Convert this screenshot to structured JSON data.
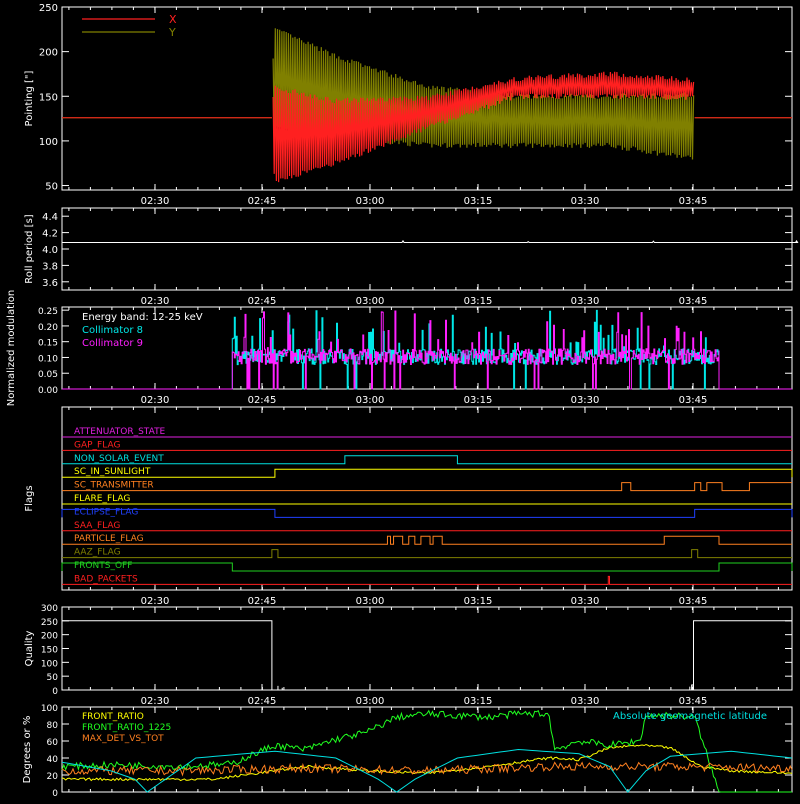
{
  "chart_data": [
    {
      "type": "line",
      "ylabel": "Pointing [\"]",
      "ylim": [
        45,
        250
      ],
      "yticks": [
        50,
        100,
        150,
        200,
        250
      ],
      "xticks": [
        "02:30",
        "02:45",
        "03:00",
        "03:15",
        "03:30",
        "03:45"
      ],
      "legend": [
        {
          "name": "X",
          "color": "#ff2020"
        },
        {
          "name": "Y",
          "color": "#808000"
        }
      ],
      "series": [
        {
          "name": "X",
          "color": "#ff2020",
          "baseline": 126,
          "envelope_upper": [
            [
              34,
              126
            ],
            [
              35,
              160
            ],
            [
              45,
              145
            ],
            [
              60,
              148
            ],
            [
              75,
              170
            ],
            [
              90,
              175
            ],
            [
              104,
              168
            ]
          ],
          "envelope_lower": [
            [
              34,
              126
            ],
            [
              35,
              55
            ],
            [
              45,
              75
            ],
            [
              60,
              115
            ],
            [
              75,
              150
            ],
            [
              90,
              150
            ],
            [
              104,
              148
            ]
          ]
        },
        {
          "name": "Y",
          "color": "#808000",
          "baseline": 126,
          "envelope_upper": [
            [
              34,
              126
            ],
            [
              35,
              225
            ],
            [
              45,
              195
            ],
            [
              60,
              160
            ],
            [
              75,
              150
            ],
            [
              90,
              150
            ],
            [
              104,
              152
            ]
          ],
          "envelope_lower": [
            [
              34,
              126
            ],
            [
              35,
              115
            ],
            [
              45,
              105
            ],
            [
              60,
              95
            ],
            [
              75,
              95
            ],
            [
              90,
              95
            ],
            [
              104,
              80
            ]
          ]
        }
      ]
    },
    {
      "type": "line",
      "ylabel": "Roll period [s]",
      "ylim": [
        3.5,
        4.5
      ],
      "yticks": [
        "3.6",
        "3.8",
        "4.0",
        "4.2",
        "4.4"
      ],
      "xticks": [
        "02:30",
        "02:45",
        "03:00",
        "03:15",
        "03:30",
        "03:45"
      ],
      "series": [
        {
          "name": "roll",
          "color": "#ffffff",
          "value": 4.08
        }
      ]
    },
    {
      "type": "bar",
      "ylabel": "Normalized modulation",
      "ylim": [
        0,
        0.26
      ],
      "yticks": [
        "0.00",
        "0.05",
        "0.10",
        "0.15",
        "0.20",
        "0.25"
      ],
      "xticks": [
        "02:30",
        "02:45",
        "03:00",
        "03:15",
        "03:30",
        "03:45"
      ],
      "annotation": "Energy band: 12-25 keV",
      "legend": [
        {
          "name": "Collimator 8",
          "color": "#00e8e8"
        },
        {
          "name": "Collimator 9",
          "color": "#ff20ff"
        }
      ],
      "series": [
        {
          "name": "Collimator 8",
          "color": "#00e8e8",
          "range": [
            28,
            108
          ],
          "mean": 0.1
        },
        {
          "name": "Collimator 9",
          "color": "#ff20ff",
          "range": [
            28,
            108
          ],
          "mean": 0.1
        }
      ]
    },
    {
      "type": "line",
      "ylabel": "Flags",
      "xticks": [
        "02:30",
        "02:45",
        "03:00",
        "03:15",
        "03:30",
        "03:45"
      ],
      "series": [
        {
          "name": "ATTENUATOR_STATE",
          "color": "#e020e0",
          "steps": []
        },
        {
          "name": "GAP_FLAG",
          "color": "#ff2020",
          "steps": []
        },
        {
          "name": "NON_SOLAR_EVENT",
          "color": "#00e0e0",
          "steps": [
            [
              46.5,
              65
            ]
          ]
        },
        {
          "name": "SC_IN_SUNLIGHT",
          "color": "#ffff00",
          "steps": [
            [
              35,
              200
            ]
          ]
        },
        {
          "name": "SC_TRANSMITTER",
          "color": "#ff8020",
          "steps": [
            [
              94,
              104
            ],
            [
              106,
              200
            ]
          ]
        },
        {
          "name": "FLARE_FLAG",
          "color": "#ffff00",
          "steps": []
        },
        {
          "name": "ECLIPSE_FLAG",
          "color": "#2040ff",
          "steps": [
            [
              0,
              35
            ],
            [
              104,
              200
            ]
          ]
        },
        {
          "name": "SAA_FLAG",
          "color": "#ff2020",
          "steps": []
        },
        {
          "name": "PARTICLE_FLAG",
          "color": "#ff8020",
          "steps": [
            [
              53,
              62
            ],
            [
              98,
              108
            ]
          ]
        },
        {
          "name": "AAZ_FLAG",
          "color": "#808000",
          "steps": [
            [
              34.5,
              35.5
            ],
            [
              103.5,
              104.5
            ]
          ]
        },
        {
          "name": "FRONTS_OFF",
          "color": "#20d020",
          "steps": [
            [
              0,
              28
            ],
            [
              108,
              200
            ]
          ]
        },
        {
          "name": "BAD_PACKETS",
          "color": "#ff2020",
          "steps": []
        }
      ]
    },
    {
      "type": "line",
      "ylabel": "Quality",
      "ylim": [
        0,
        300
      ],
      "yticks": [
        "0",
        "50",
        "100",
        "150",
        "200",
        "250",
        "300"
      ],
      "xticks": [
        "02:30",
        "02:45",
        "03:00",
        "03:15",
        "03:30",
        "03:45"
      ],
      "series": [
        {
          "name": "quality",
          "color": "#ffffff",
          "segments": [
            [
              [
                0,
                250
              ],
              [
                34.5,
                250
              ],
              [
                34.5,
                0
              ],
              [
                103.8,
                0
              ],
              [
                103.8,
                250
              ],
              [
                120,
                250
              ]
            ]
          ]
        }
      ]
    },
    {
      "type": "line",
      "ylabel": "Degrees or %",
      "ylim": [
        0,
        100
      ],
      "yticks": [
        "0",
        "20",
        "40",
        "60",
        "80",
        "100"
      ],
      "xticks": [
        "02:30",
        "02:45",
        "03:00",
        "03:15",
        "03:30",
        "03:45"
      ],
      "legend": [
        {
          "name": "FRONT_RATIO",
          "color": "#ffff00"
        },
        {
          "name": "FRONT_RATIO_1225",
          "color": "#20ff20"
        },
        {
          "name": "MAX_DET_VS_TOT",
          "color": "#ff8020"
        }
      ],
      "annotation": "Absolute geomagnetic latitude",
      "annotation_color": "#00e0e0",
      "series": [
        {
          "name": "FRONT_RATIO",
          "color": "#ffff00",
          "points": [
            [
              0,
              15
            ],
            [
              25,
              15
            ],
            [
              30,
              20
            ],
            [
              35,
              25
            ],
            [
              40,
              30
            ],
            [
              45,
              28
            ],
            [
              50,
              25
            ],
            [
              60,
              22
            ],
            [
              70,
              30
            ],
            [
              80,
              40
            ],
            [
              85,
              38
            ],
            [
              90,
              52
            ],
            [
              95,
              55
            ],
            [
              100,
              52
            ],
            [
              105,
              30
            ],
            [
              110,
              25
            ],
            [
              120,
              22
            ]
          ]
        },
        {
          "name": "FRONT_RATIO_1225",
          "color": "#20ff20",
          "points": [
            [
              0,
              30
            ],
            [
              10,
              32
            ],
            [
              20,
              30
            ],
            [
              28,
              33
            ],
            [
              30,
              40
            ],
            [
              35,
              55
            ],
            [
              40,
              50
            ],
            [
              45,
              62
            ],
            [
              50,
              70
            ],
            [
              55,
              88
            ],
            [
              60,
              92
            ],
            [
              65,
              90
            ],
            [
              70,
              88
            ],
            [
              75,
              92
            ],
            [
              80,
              92
            ],
            [
              81,
              50
            ],
            [
              85,
              60
            ],
            [
              90,
              55
            ],
            [
              95,
              60
            ],
            [
              96,
              90
            ],
            [
              100,
              90
            ],
            [
              104,
              88
            ],
            [
              108,
              0
            ],
            [
              120,
              0
            ]
          ]
        },
        {
          "name": "MAX_DET_VS_TOT",
          "color": "#ff8020",
          "points": [
            [
              0,
              25
            ],
            [
              20,
              25
            ],
            [
              40,
              28
            ],
            [
              60,
              25
            ],
            [
              80,
              30
            ],
            [
              100,
              30
            ],
            [
              120,
              28
            ]
          ]
        },
        {
          "name": "Absolute geomagnetic latitude",
          "color": "#00e0e0",
          "points": [
            [
              0,
              35
            ],
            [
              8,
              25
            ],
            [
              12,
              15
            ],
            [
              14,
              0
            ],
            [
              17,
              15
            ],
            [
              22,
              40
            ],
            [
              35,
              48
            ],
            [
              45,
              40
            ],
            [
              52,
              15
            ],
            [
              55,
              0
            ],
            [
              58,
              15
            ],
            [
              65,
              40
            ],
            [
              75,
              50
            ],
            [
              85,
              45
            ],
            [
              90,
              30
            ],
            [
              93,
              0
            ],
            [
              96,
              25
            ],
            [
              100,
              42
            ],
            [
              110,
              48
            ],
            [
              120,
              40
            ]
          ]
        }
      ]
    }
  ]
}
